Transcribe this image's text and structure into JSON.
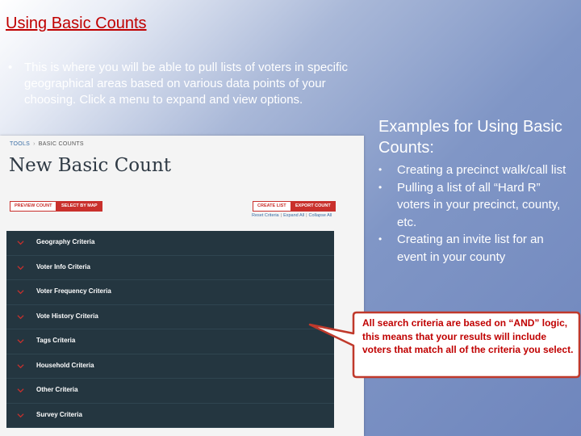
{
  "slide": {
    "title": "Using Basic Counts",
    "intro_bullet": "•",
    "intro": "This is where you will be able to pull lists of voters in specific geographical areas based on various data points of your choosing. Click a menu to expand and view options."
  },
  "screenshot": {
    "breadcrumb": {
      "tools": "TOOLS",
      "separator": "›",
      "current": "BASIC COUNTS"
    },
    "page_title": "New Basic Count",
    "buttons": {
      "preview_count": "PREVIEW COUNT",
      "select_by_map": "SELECT BY MAP",
      "create_list": "CREATE LIST",
      "export_count": "EXPORT COUNT"
    },
    "links": {
      "reset": "Reset Criteria",
      "expand": "Expand All",
      "collapse": "Collapse All",
      "separator": "|"
    },
    "criteria": [
      "Geography Criteria",
      "Voter Info Criteria",
      "Voter Frequency Criteria",
      "Vote History Criteria",
      "Tags Criteria",
      "Household Criteria",
      "Other Criteria",
      "Survey Criteria"
    ],
    "colors": {
      "panel": "#243640",
      "accent": "#c9302c",
      "chevron": "#c9302c"
    }
  },
  "examples": {
    "title": "Examples for Using Basic Counts:",
    "bullet": "•",
    "items": [
      "Creating a precinct walk/call list",
      "Pulling a list of all “Hard R” voters in your precinct, county, etc.",
      "Creating an invite list for an event in your county"
    ]
  },
  "callout": {
    "text": "All search criteria are based on “AND” logic, this means that your results will include voters that match all of the criteria you select.",
    "text_color": "#c00000",
    "border_color": "#c0392b"
  }
}
